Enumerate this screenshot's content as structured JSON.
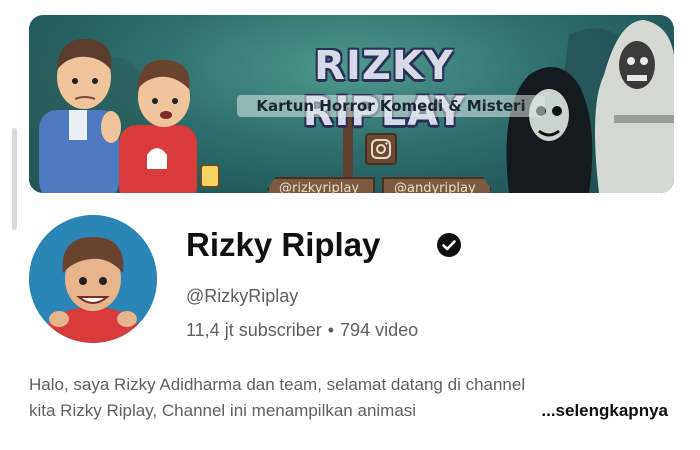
{
  "banner": {
    "title": "RIZKY RIPLAY",
    "tagline": "Kartun Horror Komedi & Misteri",
    "social_left": "@rizkyriplay",
    "social_right": "@andyriplay"
  },
  "channel": {
    "name": "Rizky Riplay",
    "handle": "@RizkyRiplay",
    "subscribers": "11,4 jt subscriber",
    "separator": "•",
    "videos": "794 video"
  },
  "description": {
    "line1": "Halo, saya Rizky Adidharma dan team, selamat datang di channel",
    "line2": "kita Rizky Riplay, Channel ini menampilkan animasi",
    "more_label": "...selengkapnya"
  },
  "icons": {
    "verified": "verified-check-icon",
    "instagram": "instagram-icon"
  },
  "colors": {
    "text_primary": "#0f0f0f",
    "text_secondary": "#606060",
    "banner_bg": "#2d6f6d"
  }
}
